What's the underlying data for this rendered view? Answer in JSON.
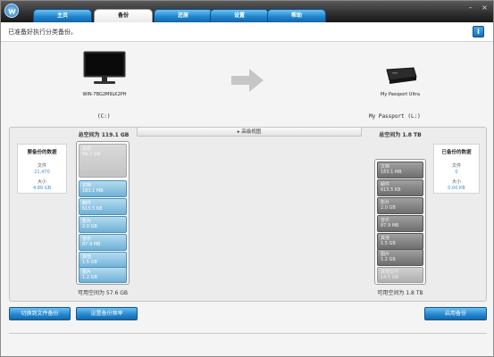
{
  "tabs": [
    {
      "label": "主页"
    },
    {
      "label": "备份"
    },
    {
      "label": "还原"
    },
    {
      "label": "设置"
    },
    {
      "label": "帮助"
    }
  ],
  "window_controls": {
    "minimize": "–",
    "close": "×"
  },
  "subheader": {
    "text": "已准备好执行分类备份。",
    "info_label": "i"
  },
  "source": {
    "computer_name": "WIN-7BG2M9LK2PH",
    "drive": "(C:)",
    "total": "总空间为 119.1 GB",
    "free": "可用空间为 57.6 GB"
  },
  "destination": {
    "drive_name": "My Passport Ultra",
    "drive": "My Passport (L:)",
    "total": "总空间为 1.8 TB",
    "free": "可用空间为 1.8 TB"
  },
  "advanced_view_label": "▸ 高级视图",
  "to_backup": {
    "title": "要备份的数据",
    "files_label": "文件",
    "files_value": "21,470",
    "size_label": "大小",
    "size_value": "4.89 GB"
  },
  "backed_up": {
    "title": "已备份的数据",
    "files_label": "文件",
    "files_value": "0",
    "size_label": "大小",
    "size_value": "0.00 KB"
  },
  "source_segments": [
    {
      "name": "系统",
      "size": "56.7 GB",
      "style": "light"
    },
    {
      "name": "文档",
      "size": "183.1 MB",
      "style": "blue"
    },
    {
      "name": "邮件",
      "size": "615.5 KB",
      "style": "blue"
    },
    {
      "name": "影片",
      "size": "2.0 GB",
      "style": "blue"
    },
    {
      "name": "音乐",
      "size": "87.9 MB",
      "style": "blue"
    },
    {
      "name": "其他",
      "size": "1.5 GB",
      "style": "blue"
    },
    {
      "name": "图片",
      "size": "1.2 GB",
      "style": "blue"
    }
  ],
  "dest_segments": [
    {
      "name": "文档",
      "size": "183.1 MB"
    },
    {
      "name": "邮件",
      "size": "615.5 KB"
    },
    {
      "name": "影片",
      "size": "2.0 GB"
    },
    {
      "name": "音乐",
      "size": "87.9 MB"
    },
    {
      "name": "其他",
      "size": "1.5 GB"
    },
    {
      "name": "图片",
      "size": "1.2 GB"
    },
    {
      "name": "其他文件",
      "size": "14.5 GB"
    }
  ],
  "buttons": {
    "switch_to_file_backup": "切换到文件备份",
    "backup_settings": "设置备份频率",
    "start_backup": "启用备份"
  },
  "colors": {
    "tab_blue": "#2186cf",
    "accent_blue": "#3b8ed6",
    "bar_blue": "#6fb2d8"
  }
}
